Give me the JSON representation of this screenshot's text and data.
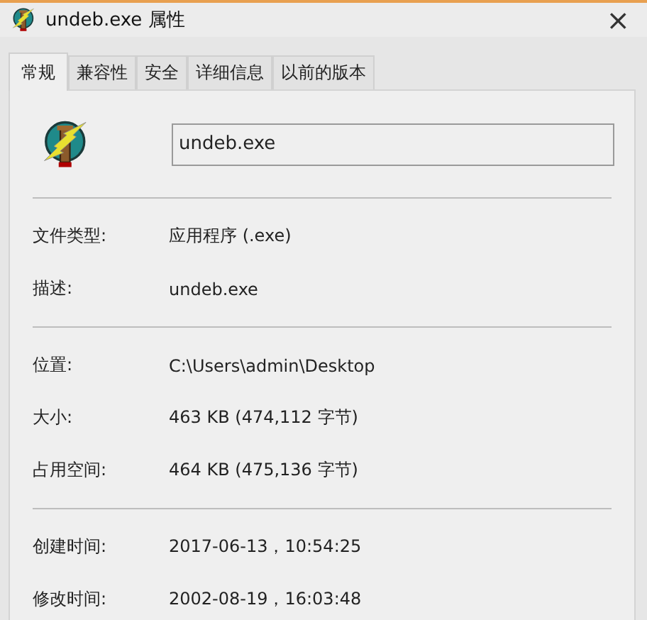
{
  "window": {
    "title": "undeb.exe 属性",
    "close": "×"
  },
  "tabs": [
    {
      "label": "常规",
      "selected": true
    },
    {
      "label": "兼容性",
      "selected": false
    },
    {
      "label": "安全",
      "selected": false
    },
    {
      "label": "详细信息",
      "selected": false
    },
    {
      "label": "以前的版本",
      "selected": false
    }
  ],
  "file_name": {
    "value": "undeb.exe"
  },
  "sections": [
    {
      "rows": [
        {
          "label": "文件类型:",
          "value": "应用程序 (.exe)"
        },
        {
          "label": "描述:",
          "value": "undeb.exe"
        }
      ]
    },
    {
      "rows": [
        {
          "label": "位置:",
          "value": "C:\\Users\\admin\\Desktop"
        },
        {
          "label": "大小:",
          "value": "463 KB (474,112 字节)"
        },
        {
          "label": "占用空间:",
          "value": "464 KB (475,136 字节)"
        }
      ]
    },
    {
      "rows": [
        {
          "label": "创建时间:",
          "value": "2017-06-13，10:54:25"
        },
        {
          "label": "修改时间:",
          "value": "2002-08-19，16:03:48"
        }
      ]
    }
  ]
}
